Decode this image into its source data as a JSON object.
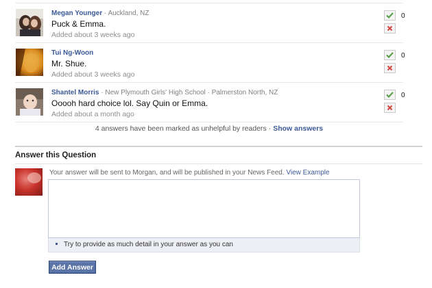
{
  "answers": [
    {
      "name": "Megan Younger",
      "separator": "·",
      "location": "Auckland, NZ",
      "text": "Puck & Emma.",
      "added": "Added about 3 weeks ago",
      "count": "0"
    },
    {
      "name": "Tui Ng-Woon",
      "separator": "",
      "location": "",
      "text": "Mr. Shue.",
      "added": "Added about 3 weeks ago",
      "count": "0"
    },
    {
      "name": "Shantel Morris",
      "separator": "·",
      "location": "New Plymouth Girls' High School · Palmerston North, NZ",
      "text": "Ooooh hard choice lol. Say Quin or Emma.",
      "added": "Added about a month ago",
      "count": "0"
    }
  ],
  "unhelpful": {
    "text": "4 answers have been marked as unhelpful by readers",
    "separator": "·",
    "link": "Show answers"
  },
  "answer_section": {
    "title": "Answer this Question",
    "notice": "Your answer will be sent to Morgan, and will be published in your News Feed.",
    "notice_link": "View Example",
    "input_value": "",
    "tip": "Try to provide as much detail in your answer as you can",
    "button": "Add Answer"
  },
  "colors": {
    "link_blue": "#3b5998",
    "button_blue": "#5b74a8",
    "upvote_green": "#5ba04a",
    "downvote_red": "#d2453f"
  },
  "icons": {
    "upvote": "checkmark-icon",
    "downvote": "x-mark-icon"
  }
}
